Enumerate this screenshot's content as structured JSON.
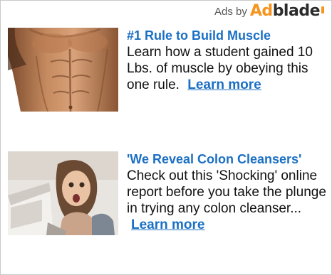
{
  "header": {
    "ads_by": "Ads by",
    "brand_ad": "Ad",
    "brand_blade": "blade"
  },
  "ads": [
    {
      "title": "#1 Rule to Build Muscle",
      "body": "Learn how a student gained 10 Lbs. of muscle by obeying this one rule.",
      "link": "Learn more",
      "image": "muscular-torso"
    },
    {
      "title": "'We Reveal Colon Cleansers'",
      "body": "Check out this 'Shocking' online report before you take the plunge in trying any colon cleanser...",
      "link": "Learn more",
      "image": "shocked-woman-at-computer"
    }
  ],
  "colors": {
    "link": "#1a6fc4",
    "brand_orange": "#f7941d",
    "brand_dark": "#2b2b2b",
    "border": "#c9c9c9"
  }
}
